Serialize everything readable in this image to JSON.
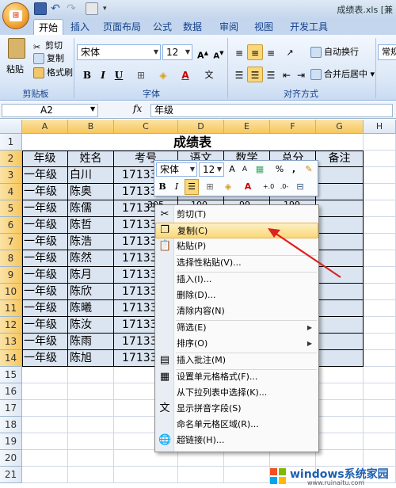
{
  "window": {
    "doc_title": "成绩表.xls [兼"
  },
  "tabs": [
    "开始",
    "插入",
    "页面布局",
    "公式",
    "数据",
    "审阅",
    "视图",
    "开发工具"
  ],
  "ribbon": {
    "clipboard": {
      "paste": "粘贴",
      "cut": "剪切",
      "copy": "复制",
      "format_painter": "格式刷",
      "group": "剪贴板"
    },
    "font": {
      "name": "宋体",
      "size": "12",
      "group": "字体",
      "bold": "B",
      "italic": "I",
      "underline": "U"
    },
    "alignment": {
      "wrap": "自动换行",
      "merge": "合并后居中",
      "group": "对齐方式"
    },
    "number": {
      "format": "常规"
    }
  },
  "formula_bar": {
    "name_box": "A2",
    "fx": "fx",
    "content": "年级"
  },
  "columns": [
    "A",
    "B",
    "C",
    "D",
    "E",
    "F",
    "G",
    "H"
  ],
  "rows": [
    "1",
    "2",
    "3",
    "4",
    "5",
    "6",
    "7",
    "8",
    "9",
    "10",
    "11",
    "12",
    "13",
    "14",
    "15",
    "16",
    "17",
    "18",
    "19",
    "20",
    "21"
  ],
  "sheet": {
    "title": "成绩表",
    "headers": [
      "年级",
      "姓名",
      "考号",
      "语文",
      "数学",
      "总分",
      "备注"
    ],
    "data": [
      [
        "一年级",
        "白川",
        "171330"
      ],
      [
        "一年级",
        "陈奥",
        "171330"
      ],
      [
        "一年级",
        "陈儒",
        "171330"
      ],
      [
        "一年级",
        "陈哲",
        "171330"
      ],
      [
        "一年级",
        "陈浩",
        "171330"
      ],
      [
        "一年级",
        "陈然",
        "171330"
      ],
      [
        "一年级",
        "陈月",
        "171330"
      ],
      [
        "一年级",
        "陈欣",
        "171330"
      ],
      [
        "一年级",
        "陈曦",
        "171330"
      ],
      [
        "一年级",
        "陈汝",
        "171330"
      ],
      [
        "一年级",
        "陈雨",
        "171330"
      ],
      [
        "一年级",
        "陈旭",
        "171330"
      ]
    ],
    "partial_r5": [
      "305",
      "100",
      "99",
      "199"
    ]
  },
  "mini_toolbar": {
    "font": "宋体",
    "size": "12",
    "bold": "B",
    "italic": "I",
    "percent": "%",
    "comma": ",",
    "inc": ".0→.00",
    "dec": ".00→.0"
  },
  "context_menu": [
    {
      "label": "剪切(T)",
      "icon": "scissors-icon"
    },
    {
      "label": "复制(C)",
      "icon": "copy-icon",
      "highlighted": true
    },
    {
      "label": "粘贴(P)",
      "icon": "paste-icon"
    },
    {
      "label": "选择性粘贴(V)...",
      "icon": ""
    },
    {
      "label": "插入(I)...",
      "icon": ""
    },
    {
      "label": "删除(D)...",
      "icon": ""
    },
    {
      "label": "清除内容(N)",
      "icon": ""
    },
    {
      "label": "筛选(E)",
      "icon": "",
      "submenu": true
    },
    {
      "label": "排序(O)",
      "icon": "",
      "submenu": true
    },
    {
      "label": "插入批注(M)",
      "icon": "comment-icon"
    },
    {
      "label": "设置单元格格式(F)...",
      "icon": "format-cells-icon"
    },
    {
      "label": "从下拉列表中选择(K)...",
      "icon": ""
    },
    {
      "label": "显示拼音字段(S)",
      "icon": "phonetic-icon"
    },
    {
      "label": "命名单元格区域(R)...",
      "icon": ""
    },
    {
      "label": "超链接(H)...",
      "icon": "hyperlink-icon"
    }
  ],
  "watermark": {
    "main": "windows系统家园",
    "sub": "www.ruinaitu.com"
  }
}
